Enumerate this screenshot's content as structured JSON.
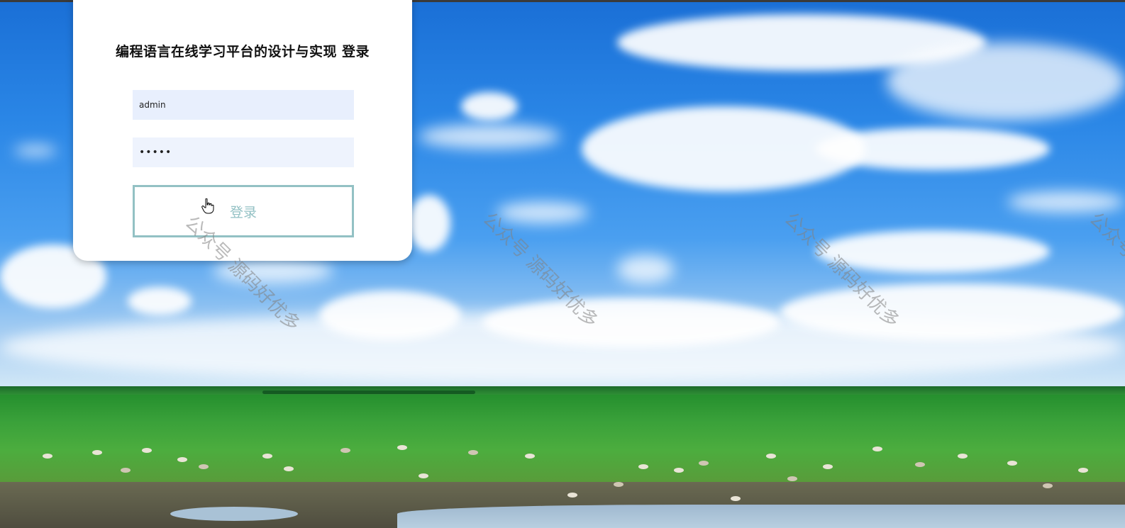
{
  "login": {
    "title": "编程语言在线学习平台的设计与实现 登录",
    "username_value": "admin",
    "password_value": "•••••",
    "submit_label": "登录"
  },
  "watermark": {
    "text": "公众号 源码好优多"
  },
  "icons": {
    "cursor": "hand-pointer-icon"
  },
  "colors": {
    "button_border": "#93c1c4",
    "username_bg": "#e8effd",
    "password_bg": "#eef3fd"
  }
}
